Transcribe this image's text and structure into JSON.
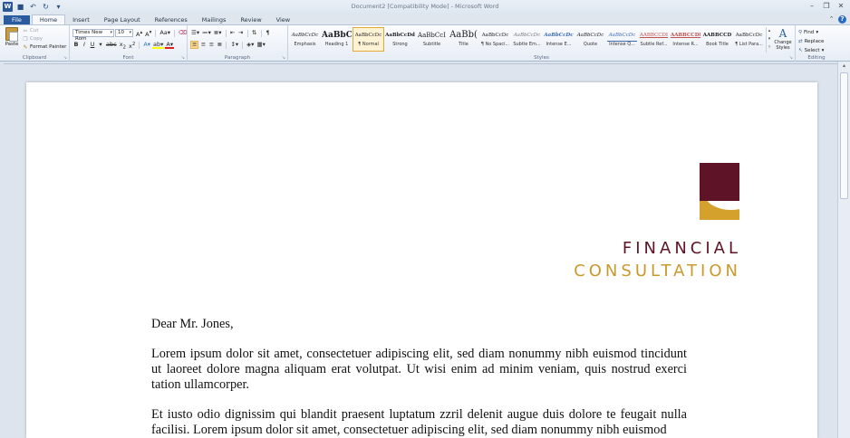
{
  "window": {
    "title": "Document2 [Compatibility Mode] - Microsoft Word",
    "app_icon": "W"
  },
  "tabs": [
    "File",
    "Home",
    "Insert",
    "Page Layout",
    "References",
    "Mailings",
    "Review",
    "View"
  ],
  "active_tab": "Home",
  "clipboard": {
    "paste": "Paste",
    "cut": "Cut",
    "copy": "Copy",
    "format_painter": "Format Painter",
    "label": "Clipboard"
  },
  "font": {
    "name": "Times New Rom",
    "size": "10",
    "label": "Font"
  },
  "paragraph": {
    "label": "Paragraph"
  },
  "styles": {
    "label": "Styles",
    "items": [
      {
        "sample": "AaBbCcDc",
        "name": "Emphasis"
      },
      {
        "sample": "AaBbC",
        "name": "Heading 1"
      },
      {
        "sample": "AaBbCcDc",
        "name": "¶ Normal"
      },
      {
        "sample": "AaBbCcDd",
        "name": "Strong"
      },
      {
        "sample": "AaBbCcI",
        "name": "Subtitle"
      },
      {
        "sample": "AaBb(",
        "name": "Title"
      },
      {
        "sample": "AaBbCcDc",
        "name": "¶ No Spaci..."
      },
      {
        "sample": "AaBbCcDc",
        "name": "Subtle Em..."
      },
      {
        "sample": "AaBbCcDc",
        "name": "Intense E..."
      },
      {
        "sample": "AaBbCcDc",
        "name": "Quote"
      },
      {
        "sample": "AaBbCcDc",
        "name": "Intense Q..."
      },
      {
        "sample": "AABBCCDI",
        "name": "Subtle Ref..."
      },
      {
        "sample": "AABBCCDI",
        "name": "Intense R..."
      },
      {
        "sample": "AABBCCD",
        "name": "Book Title"
      },
      {
        "sample": "AaBbCcDc",
        "name": "¶ List Para..."
      }
    ],
    "change_styles": "Change Styles"
  },
  "editing": {
    "label": "Editing",
    "find": "Find",
    "replace": "Replace",
    "select": "Select"
  },
  "document": {
    "brand_line1": "FINANCIAL",
    "brand_line2": "CONSULTATION",
    "salutation": "Dear Mr. Jones,",
    "paragraph1": "Lorem ipsum dolor sit amet, consectetuer adipiscing elit, sed diam nonummy nibh euismod tincidunt ut laoreet dolore magna aliquam erat volutpat. Ut wisi enim ad minim veniam, quis nostrud exerci tation ullamcorper.",
    "paragraph2": "Et iusto odio dignissim qui blandit praesent luptatum zzril delenit augue duis dolore te feugait nulla facilisi. Lorem ipsum dolor sit amet, consectetuer adipiscing elit, sed diam nonummy nibh euismod"
  },
  "colors": {
    "brand_maroon": "#5e1426",
    "brand_gold": "#c9992c",
    "file_tab": "#2a5b9f"
  }
}
